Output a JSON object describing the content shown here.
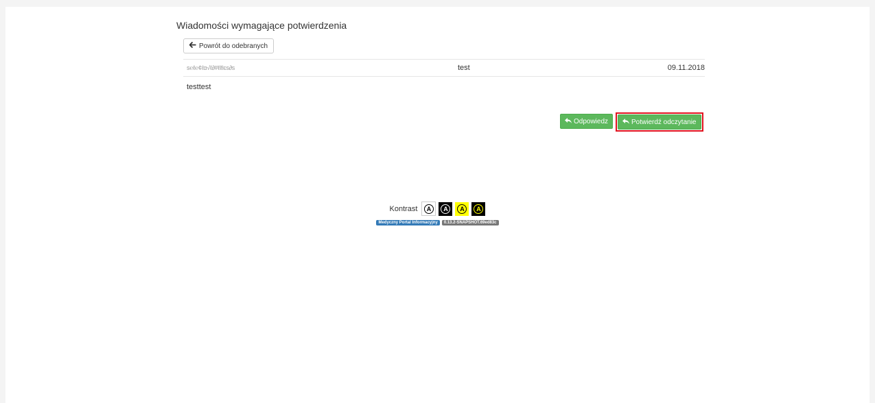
{
  "page": {
    "title": "Wiadomości wymagające potwierdzenia",
    "back_label": "Powrót do odebranych"
  },
  "message": {
    "sender": "ѕ℮ℓ℮¢ℓα√ℓ∂#ℓℓℓєѕ∂ѕ",
    "subject": "test",
    "date": "09.11.2018",
    "body": "testtest"
  },
  "actions": {
    "reply_label": "Odpowiedz",
    "confirm_label": "Potwierdź odczytanie"
  },
  "footer": {
    "contrast_label": "Kontrast",
    "contrast_glyph": "A",
    "portal_badge": "Medyczny Portal Informacyjny",
    "version_badge": "0.13.2-SNAPSHOT.69ed83c"
  },
  "colors": {
    "success": "#5cb85c",
    "highlight": "#e0111d",
    "badge_primary": "#337ab7",
    "badge_default": "#777777"
  },
  "icons": {
    "back": "arrow-left-icon",
    "reply": "reply-icon"
  }
}
